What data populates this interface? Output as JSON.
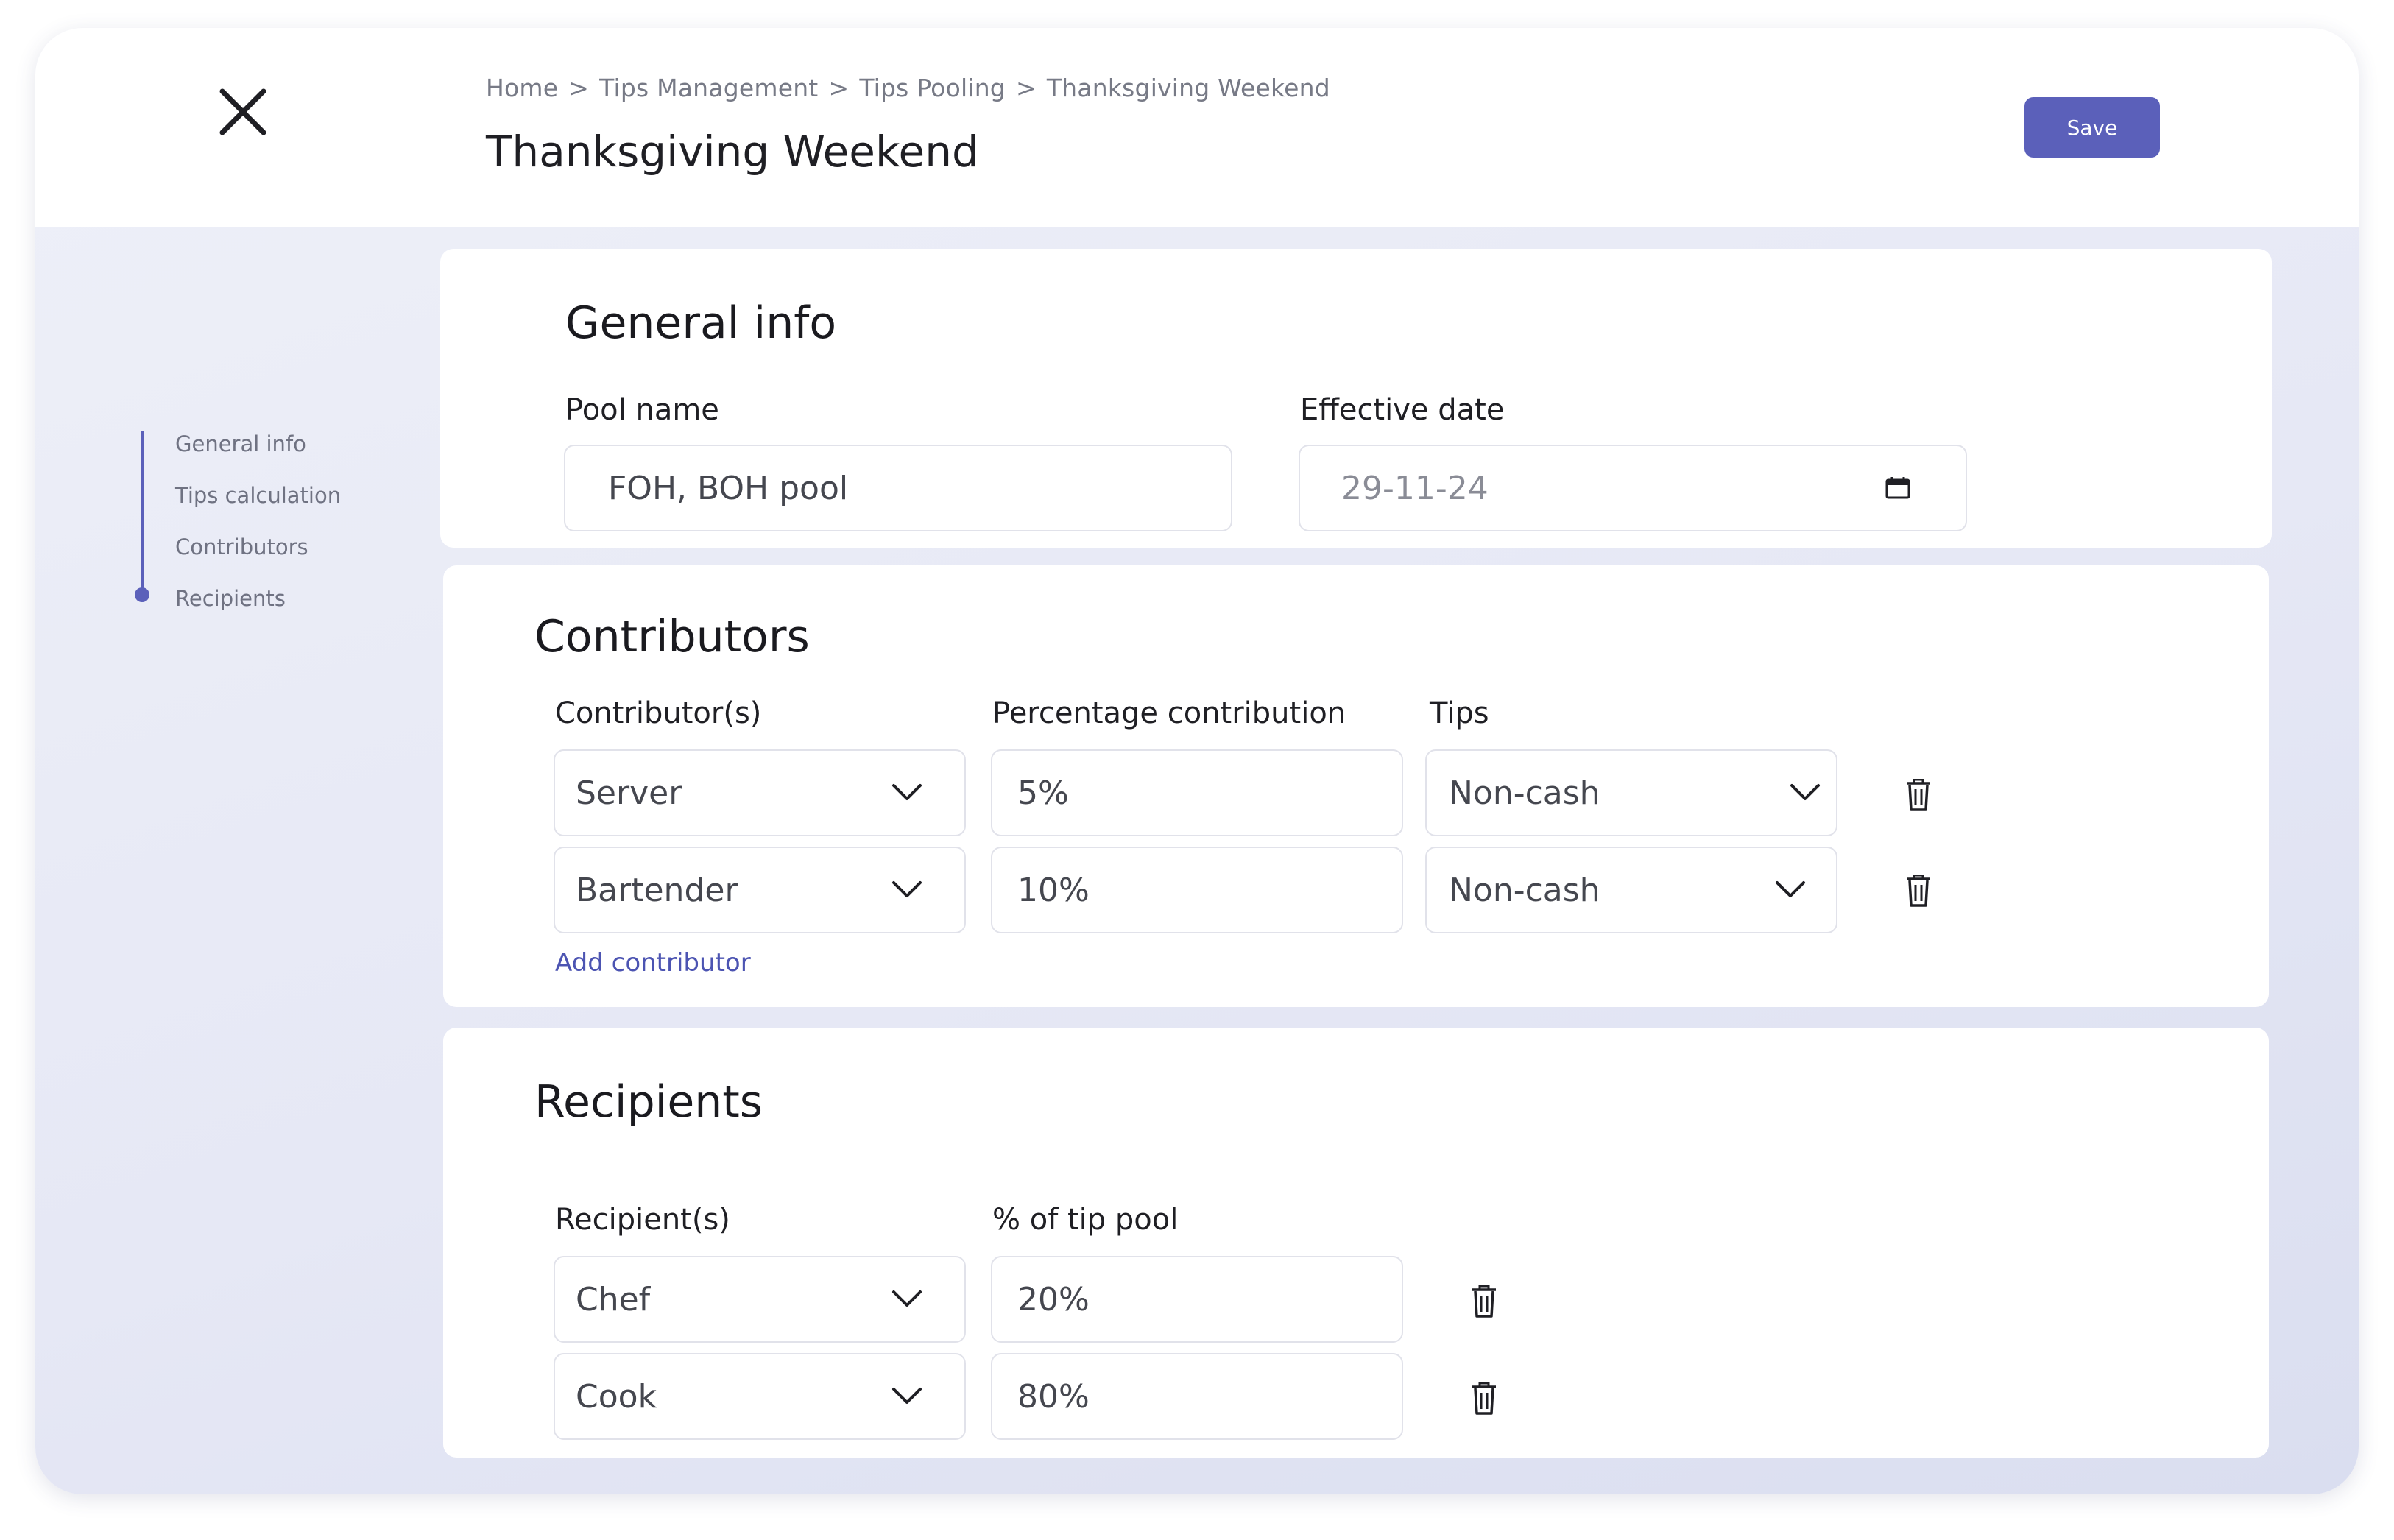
{
  "header": {
    "breadcrumb": [
      "Home",
      "Tips Management",
      "Tips Pooling",
      "Thanksgiving Weekend"
    ],
    "breadcrumb_separator": ">",
    "title": "Thanksgiving Weekend",
    "save_label": "Save",
    "close_icon": "close-icon"
  },
  "sidebar": {
    "steps": [
      "General info",
      "Tips calculation",
      "Contributors",
      "Recipients"
    ],
    "active_step": "Recipients"
  },
  "general_info": {
    "heading": "General info",
    "pool_name_label": "Pool name",
    "pool_name_value": "FOH, BOH pool",
    "effective_date_label": "Effective date",
    "effective_date_value": "29-11-24"
  },
  "contributors": {
    "heading": "Contributors",
    "columns": [
      "Contributor(s)",
      "Percentage contribution",
      "Tips"
    ],
    "rows": [
      {
        "role": "Server",
        "percentage": "5%",
        "tips": "Non-cash"
      },
      {
        "role": "Bartender",
        "percentage": "10%",
        "tips": "Non-cash"
      }
    ],
    "add_label": "Add contributor"
  },
  "recipients": {
    "heading": "Recipients",
    "columns": [
      "Recipient(s)",
      "% of tip pool"
    ],
    "rows": [
      {
        "role": "Chef",
        "share": "20%"
      },
      {
        "role": "Cook",
        "share": "80%"
      }
    ]
  },
  "colors": {
    "accent": "#5b60ba",
    "link": "#4c54b2",
    "background": "#e6e8f5",
    "card": "#ffffff"
  }
}
